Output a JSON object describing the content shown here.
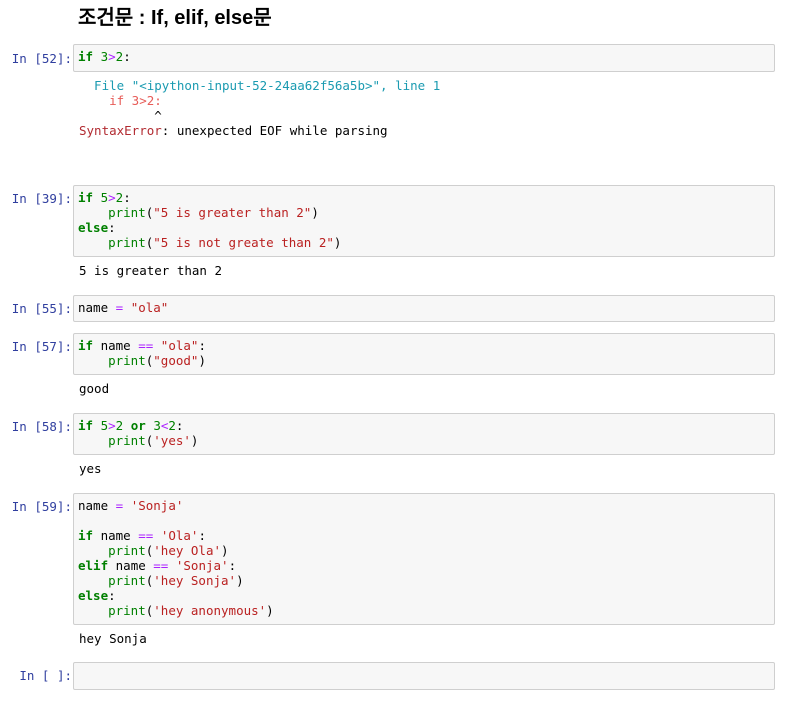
{
  "heading": "조건문 : If, elif, else문",
  "cells": {
    "c52": {
      "prompt": "In [52]:",
      "code": {
        "kw_if": "if",
        "n1": "3",
        "op": ">",
        "n2": "2",
        "colon": ":"
      },
      "error": {
        "file_label": "  File ",
        "file_str": "\"<ipython-input-52-24aa62f56a5b>\"",
        "line_label": ", line ",
        "line_num": "1",
        "src_line": "    if 3>2:",
        "caret": "          ^",
        "err_name": "SyntaxError",
        "err_msg": ": unexpected EOF while parsing"
      }
    },
    "c39": {
      "prompt": "In [39]:",
      "kw_if": "if",
      "n1": "5",
      "op": ">",
      "n2": "2",
      "colon": ":",
      "indent": "    ",
      "fn": "print",
      "s1": "\"5 is greater than 2\"",
      "kw_else": "else",
      "s2": "\"5 is not greate than 2\"",
      "output": "5 is greater than 2"
    },
    "c55": {
      "prompt": "In [55]:",
      "var": "name",
      "op": " = ",
      "val": "\"ola\""
    },
    "c57": {
      "prompt": "In [57]:",
      "kw_if": "if",
      "var": " name ",
      "op": "==",
      "val": " \"ola\"",
      "colon": ":",
      "indent": "    ",
      "fn": "print",
      "s": "\"good\"",
      "output": "good"
    },
    "c58": {
      "prompt": "In [58]:",
      "kw_if": "if",
      "n1": "5",
      "op1": ">",
      "n2": "2",
      "kw_or": "or",
      "n3": "3",
      "op2": "<",
      "n4": "2",
      "colon": ":",
      "indent": "    ",
      "fn": "print",
      "s": "'yes'",
      "output": "yes"
    },
    "c59": {
      "prompt": "In [59]:",
      "var": "name",
      "eq": " = ",
      "val": "'Sonja'",
      "kw_if": "if",
      "cmp": "==",
      "v1": "'Ola'",
      "s1": "'hey Ola'",
      "kw_elif": "elif",
      "v2": "'Sonja'",
      "s2": "'hey Sonja'",
      "kw_else": "else",
      "s3": "'hey anonymous'",
      "fn": "print",
      "indent": "    ",
      "output": "hey Sonja"
    },
    "empty": {
      "prompt": "In [ ]:"
    }
  }
}
